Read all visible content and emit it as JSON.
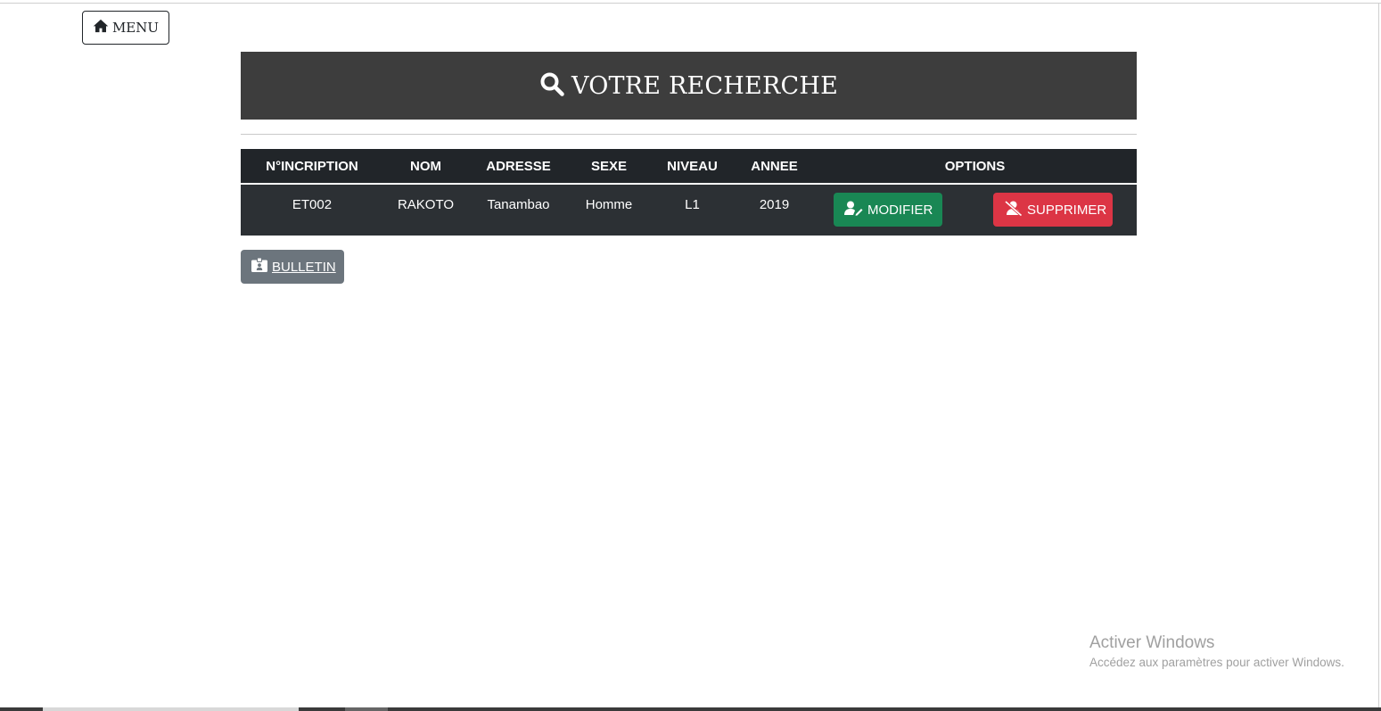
{
  "nav": {
    "menu_label": "MENU",
    "menu_icon": "home-icon"
  },
  "banner": {
    "title": "VOTRE RECHERCHE",
    "icon": "search-icon"
  },
  "table": {
    "headers": [
      "N°INCRIPTION",
      "NOM",
      "ADRESSE",
      "SEXE",
      "NIVEAU",
      "ANNEE",
      "OPTIONS"
    ],
    "rows": [
      {
        "inscription": "ET002",
        "nom": "RAKOTO",
        "adresse": "Tanambao",
        "sexe": "Homme",
        "niveau": "L1",
        "annee": "2019"
      }
    ],
    "actions": {
      "modifier": "MODIFIER",
      "supprimer": "SUPPRIMER"
    }
  },
  "bulletin": {
    "label": "BULLETIN",
    "icon": "id-card-icon"
  },
  "watermark": {
    "title": "Activer Windows",
    "subtitle": "Accédez aux paramètres pour activer Windows."
  },
  "colors": {
    "banner_bg": "#3d3d3d",
    "table_bg": "#212529",
    "success": "#198754",
    "danger": "#dc3545",
    "secondary": "#6c757d"
  }
}
